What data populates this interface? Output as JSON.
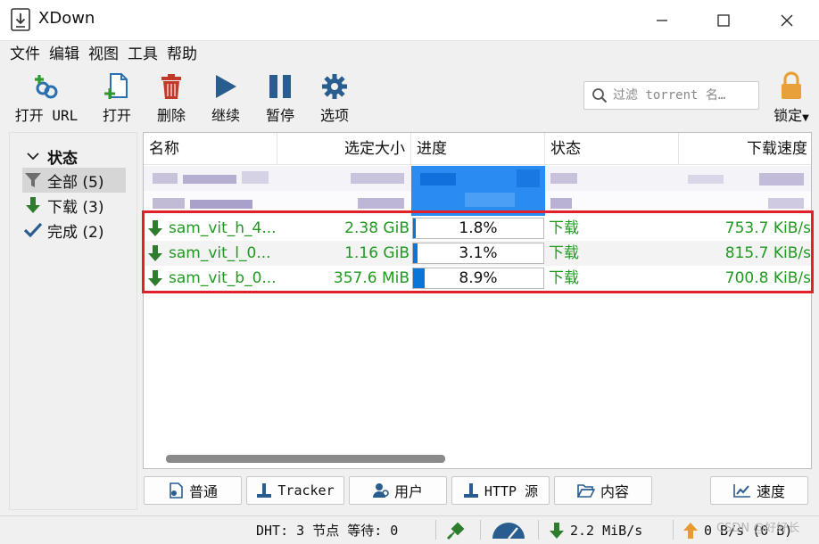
{
  "window": {
    "title": "XDown",
    "icon": "download-box-icon",
    "controls": [
      "minimize-icon",
      "maximize-icon",
      "close-icon"
    ]
  },
  "menu": [
    "文件",
    "编辑",
    "视图",
    "工具",
    "帮助"
  ],
  "toolbar": {
    "open_url": "打开 URL",
    "open": "打开",
    "delete": "删除",
    "resume": "继续",
    "pause": "暂停",
    "options": "选项",
    "filter_placeholder": "过滤 torrent 名…",
    "lock": "锁定"
  },
  "sidebar": {
    "header": "状态",
    "items": [
      {
        "label": "全部 (5)",
        "icon": "filter-icon",
        "selected": true
      },
      {
        "label": "下载 (3)",
        "icon": "down-arrow-icon"
      },
      {
        "label": "完成 (2)",
        "icon": "checkmark-icon"
      }
    ]
  },
  "table": {
    "columns": [
      "名称",
      "选定大小",
      "进度",
      "状态",
      "下载速度"
    ],
    "rows": [
      {
        "name": "sam_vit_h_4...",
        "size": "2.38 GiB",
        "progress": "1.8%",
        "progress_value": 0.018,
        "status": "下载",
        "speed": "753.7 KiB/s"
      },
      {
        "name": "sam_vit_l_0...",
        "size": "1.16 GiB",
        "progress": "3.1%",
        "progress_value": 0.031,
        "status": "下载",
        "speed": "815.7 KiB/s"
      },
      {
        "name": "sam_vit_b_0...",
        "size": "357.6 MiB",
        "progress": "8.9%",
        "progress_value": 0.089,
        "status": "下载",
        "speed": "700.8 KiB/s"
      }
    ]
  },
  "tabs": {
    "general": "普通",
    "tracker": "Tracker",
    "peers": "用户",
    "http": "HTTP 源",
    "content": "内容",
    "speed": "速度"
  },
  "statusbar": {
    "dht": "DHT: 3 节点 等待: 0",
    "download_rate": "2.2 MiB/s",
    "upload_rate": "0 B/s (0 B)"
  },
  "watermark": "CSDN @好好长"
}
